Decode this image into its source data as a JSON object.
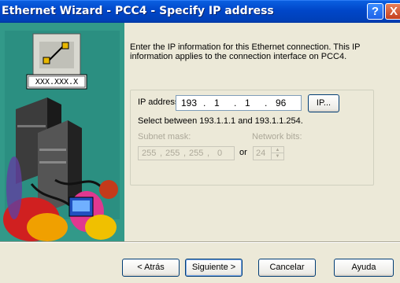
{
  "window": {
    "title": "Ethernet Wizard - PCC4 - Specify IP address",
    "help_glyph": "?",
    "close_glyph": "X"
  },
  "image": {
    "box_label": "XXX.XXX.X"
  },
  "intro_text": "Enter the IP information for this Ethernet connection. This IP information applies to the connection interface on PCC4.",
  "ip": {
    "label": "IP address:",
    "octets": [
      "193",
      "1",
      "1",
      "96"
    ],
    "dot": ".",
    "button": "IP...",
    "hint": "Select between 193.1.1.1 and 193.1.1.254."
  },
  "subnet": {
    "label": "Subnet mask:",
    "octets": [
      "255",
      "255",
      "255",
      "0"
    ],
    "dot": ",",
    "or": "or"
  },
  "network_bits": {
    "label": "Network bits:",
    "value": "24"
  },
  "buttons": {
    "back": "< Atrás",
    "next": "Siguiente >",
    "cancel": "Cancelar",
    "help": "Ayuda"
  }
}
